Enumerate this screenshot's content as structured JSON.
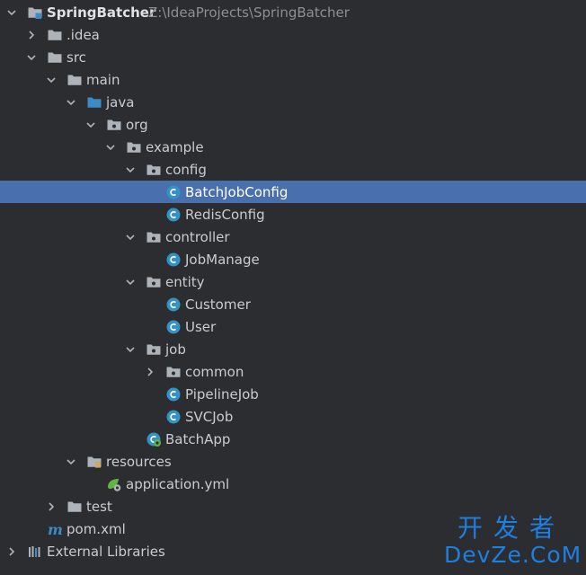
{
  "project": {
    "name": "SpringBatcher",
    "path": "Z:\\IdeaProjects\\SpringBatcher"
  },
  "tree": [
    {
      "label": "SpringBatcher",
      "hint": "Z:\\IdeaProjects\\SpringBatcher",
      "depth": 0,
      "icon": "module-folder-icon",
      "expanded": true,
      "bold": true
    },
    {
      "label": ".idea",
      "depth": 1,
      "icon": "folder-icon",
      "expanded": false
    },
    {
      "label": "src",
      "depth": 1,
      "icon": "folder-icon",
      "expanded": true
    },
    {
      "label": "main",
      "depth": 2,
      "icon": "folder-icon",
      "expanded": true
    },
    {
      "label": "java",
      "depth": 3,
      "icon": "source-folder-icon",
      "expanded": true
    },
    {
      "label": "org",
      "depth": 4,
      "icon": "package-icon",
      "expanded": true
    },
    {
      "label": "example",
      "depth": 5,
      "icon": "package-icon",
      "expanded": true
    },
    {
      "label": "config",
      "depth": 6,
      "icon": "package-icon",
      "expanded": true
    },
    {
      "label": "BatchJobConfig",
      "depth": 7,
      "icon": "java-class-icon",
      "selected": true
    },
    {
      "label": "RedisConfig",
      "depth": 7,
      "icon": "java-class-icon"
    },
    {
      "label": "controller",
      "depth": 6,
      "icon": "package-icon",
      "expanded": true
    },
    {
      "label": "JobManage",
      "depth": 7,
      "icon": "java-class-icon"
    },
    {
      "label": "entity",
      "depth": 6,
      "icon": "package-icon",
      "expanded": true
    },
    {
      "label": "Customer",
      "depth": 7,
      "icon": "java-class-icon"
    },
    {
      "label": "User",
      "depth": 7,
      "icon": "java-class-icon"
    },
    {
      "label": "job",
      "depth": 6,
      "icon": "package-icon",
      "expanded": true
    },
    {
      "label": "common",
      "depth": 7,
      "icon": "package-icon",
      "expanded": false
    },
    {
      "label": "PipelineJob",
      "depth": 7,
      "icon": "java-class-icon"
    },
    {
      "label": "SVCJob",
      "depth": 7,
      "icon": "java-class-icon"
    },
    {
      "label": "BatchApp",
      "depth": 6,
      "icon": "spring-boot-class-icon"
    },
    {
      "label": "resources",
      "depth": 3,
      "icon": "resources-folder-icon",
      "expanded": true
    },
    {
      "label": "application.yml",
      "depth": 4,
      "icon": "spring-yaml-icon"
    },
    {
      "label": "test",
      "depth": 2,
      "icon": "folder-icon",
      "expanded": false
    },
    {
      "label": "pom.xml",
      "depth": 1,
      "icon": "maven-icon"
    },
    {
      "label": "External Libraries",
      "depth": 0,
      "icon": "libraries-icon",
      "expanded": false
    }
  ],
  "watermark": {
    "top": "开发者",
    "bottom": "DevZe.CoM"
  },
  "colors": {
    "background": "#2b2d30",
    "selection": "#4a6fad",
    "text": "#c9ccd1",
    "folder": "#aeb3ba",
    "source_folder": "#3b8cc4",
    "class_circle": "#3592c4",
    "spring_green": "#62b543",
    "watermark": "#1e7fe0"
  }
}
